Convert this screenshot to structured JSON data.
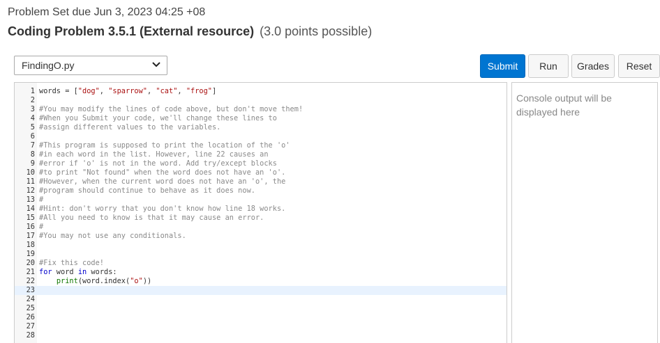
{
  "header": {
    "due": "Problem Set due Jun 3, 2023 04:25 +08",
    "title": "Coding Problem 3.5.1 (External resource)",
    "points": "(3.0 points possible)"
  },
  "file_select": {
    "value": "FindingO.py"
  },
  "buttons": {
    "submit": "Submit",
    "run": "Run",
    "grades": "Grades",
    "reset": "Reset"
  },
  "editor": {
    "active_line": 23,
    "lines": [
      {
        "n": "1",
        "segs": [
          {
            "t": "words = ["
          },
          {
            "t": "\"dog\"",
            "c": "str"
          },
          {
            "t": ", "
          },
          {
            "t": "\"sparrow\"",
            "c": "str"
          },
          {
            "t": ", "
          },
          {
            "t": "\"cat\"",
            "c": "str"
          },
          {
            "t": ", "
          },
          {
            "t": "\"frog\"",
            "c": "str"
          },
          {
            "t": "]"
          }
        ]
      },
      {
        "n": "2",
        "segs": []
      },
      {
        "n": "3",
        "segs": [
          {
            "t": "#You may modify the lines of code above, but don't move them!",
            "c": "cm"
          }
        ]
      },
      {
        "n": "4",
        "segs": [
          {
            "t": "#When you Submit your code, we'll change these lines to",
            "c": "cm"
          }
        ]
      },
      {
        "n": "5",
        "segs": [
          {
            "t": "#assign different values to the variables.",
            "c": "cm"
          }
        ]
      },
      {
        "n": "6",
        "segs": []
      },
      {
        "n": "7",
        "segs": [
          {
            "t": "#This program is supposed to print the location of the 'o'",
            "c": "cm"
          }
        ]
      },
      {
        "n": "8",
        "segs": [
          {
            "t": "#in each word in the list. However, line 22 causes an",
            "c": "cm"
          }
        ]
      },
      {
        "n": "9",
        "segs": [
          {
            "t": "#error if 'o' is not in the word. Add try/except blocks",
            "c": "cm"
          }
        ]
      },
      {
        "n": "10",
        "segs": [
          {
            "t": "#to print \"Not found\" when the word does not have an 'o'.",
            "c": "cm"
          }
        ]
      },
      {
        "n": "11",
        "segs": [
          {
            "t": "#However, when the current word does not have an 'o', the",
            "c": "cm"
          }
        ]
      },
      {
        "n": "12",
        "segs": [
          {
            "t": "#program should continue to behave as it does now.",
            "c": "cm"
          }
        ]
      },
      {
        "n": "13",
        "segs": [
          {
            "t": "#",
            "c": "cm"
          }
        ]
      },
      {
        "n": "14",
        "segs": [
          {
            "t": "#Hint: don't worry that you don't know how line 18 works.",
            "c": "cm"
          }
        ]
      },
      {
        "n": "15",
        "segs": [
          {
            "t": "#All you need to know is that it may cause an error.",
            "c": "cm"
          }
        ]
      },
      {
        "n": "16",
        "segs": [
          {
            "t": "#",
            "c": "cm"
          }
        ]
      },
      {
        "n": "17",
        "segs": [
          {
            "t": "#You may not use any conditionals.",
            "c": "cm"
          }
        ]
      },
      {
        "n": "18",
        "segs": []
      },
      {
        "n": "19",
        "segs": []
      },
      {
        "n": "20",
        "segs": [
          {
            "t": "#Fix this code!",
            "c": "cm"
          }
        ]
      },
      {
        "n": "21",
        "segs": [
          {
            "t": "for",
            "c": "kw"
          },
          {
            "t": " word "
          },
          {
            "t": "in",
            "c": "kw"
          },
          {
            "t": " words:"
          }
        ]
      },
      {
        "n": "22",
        "segs": [
          {
            "t": "    "
          },
          {
            "t": "print",
            "c": "fn"
          },
          {
            "t": "(word.index("
          },
          {
            "t": "\"o\"",
            "c": "str"
          },
          {
            "t": "))"
          }
        ]
      },
      {
        "n": "23",
        "segs": []
      },
      {
        "n": "24",
        "segs": []
      },
      {
        "n": "25",
        "segs": []
      },
      {
        "n": "26",
        "segs": []
      },
      {
        "n": "27",
        "segs": []
      },
      {
        "n": "28",
        "segs": []
      }
    ]
  },
  "console": {
    "placeholder": "Console output will be displayed here"
  }
}
